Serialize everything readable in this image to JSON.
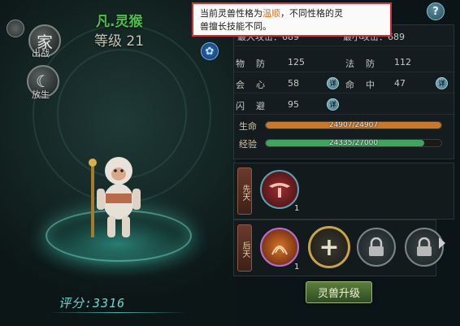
{
  "tooltip": {
    "prefix": "当前灵兽性格为",
    "personality": "温顺",
    "suffix": "，不同性格的灵",
    "line2": "兽擅长技能不同。"
  },
  "side_buttons": [
    {
      "glyph": "家",
      "label": "出战"
    },
    {
      "glyph": "☾",
      "label": "放生"
    }
  ],
  "pet": {
    "name": "凡.灵猴",
    "level_label": "等级",
    "level": "21",
    "score_label": "评分",
    "score": "3316"
  },
  "stats": {
    "row0": {
      "left": "最大攻击：689",
      "right": "最小攻击：689"
    },
    "row1": {
      "left_label": "物    防",
      "left_value": "125",
      "right_label": "法    防",
      "right_value": "112"
    },
    "row2": {
      "left_label": "会    心",
      "left_value": "58",
      "right_label": "命    中",
      "right_value": "47"
    },
    "row3": {
      "left_label": "闪    避",
      "left_value": "95"
    },
    "detail_glyph": "详"
  },
  "bars": {
    "hp": {
      "label": "生命",
      "text": "24907/24907",
      "fill_fraction": 1.0,
      "color": "#c8782a"
    },
    "exp": {
      "label": "经验",
      "text": "24335/27000",
      "fill_fraction": 0.901,
      "color": "#3ea560"
    }
  },
  "skills": {
    "innate_tag": "先天",
    "acquired_tag": "后天",
    "innate": [
      {
        "count": "1"
      }
    ],
    "acquired": [
      {
        "count": "1"
      }
    ],
    "add_glyph": "+"
  },
  "buttons": {
    "upgrade": "灵兽升级",
    "help": "?"
  }
}
